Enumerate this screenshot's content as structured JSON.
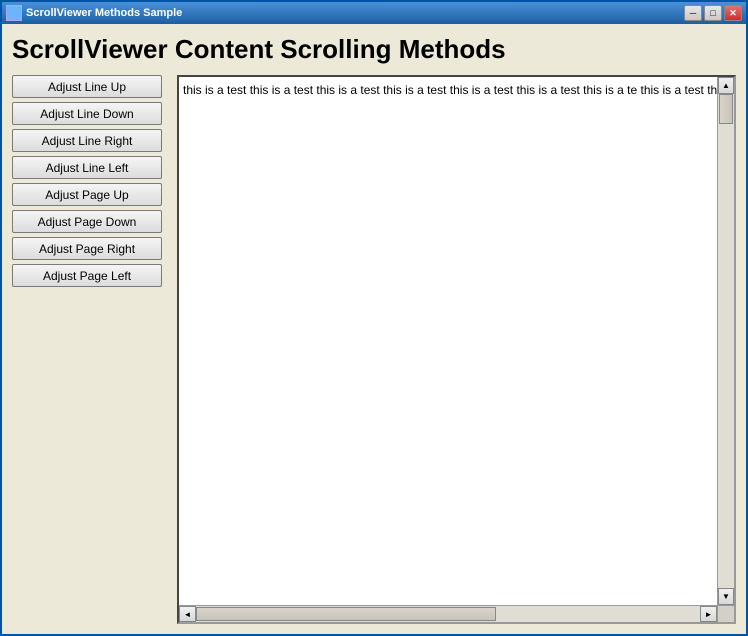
{
  "window": {
    "title": "ScrollViewer Methods Sample",
    "icon": "window-icon"
  },
  "title_bar_buttons": {
    "minimize_label": "─",
    "maximize_label": "□",
    "close_label": "✕"
  },
  "page": {
    "title": "ScrollViewer Content Scrolling Methods"
  },
  "buttons": [
    {
      "id": "adjust-line-up",
      "label": "Adjust Line Up"
    },
    {
      "id": "adjust-line-down",
      "label": "Adjust Line Down"
    },
    {
      "id": "adjust-line-right",
      "label": "Adjust Line Right"
    },
    {
      "id": "adjust-line-left",
      "label": "Adjust Line Left"
    },
    {
      "id": "adjust-page-up",
      "label": "Adjust Page Up"
    },
    {
      "id": "adjust-page-down",
      "label": "Adjust Page Down"
    },
    {
      "id": "adjust-page-right",
      "label": "Adjust Page Right"
    },
    {
      "id": "adjust-page-left",
      "label": "Adjust Page Left"
    }
  ],
  "scroll_content": {
    "text": "this is a test this is a test this is a test this is a test this is a test this is a test this is a te this is a test this is a test this is a test this is a test this is a test this is a test this is a t is a test this is a test this is a test this is a test this is a test this is a test this is a test this is this is a test this is a test this is a test this is a test this is a test this is a test this is a tl test this is a test this is a test this is a test this is a test this is a test this is a test this is a b a test this is a test this is a test this is a test this is a test this is a test this is a test this is a is a test this is a test this is a test this is a test this is a test this is a test this is a test this is"
  },
  "scrollbar": {
    "up_arrow": "▲",
    "down_arrow": "▼",
    "left_arrow": "◄",
    "right_arrow": "►"
  }
}
